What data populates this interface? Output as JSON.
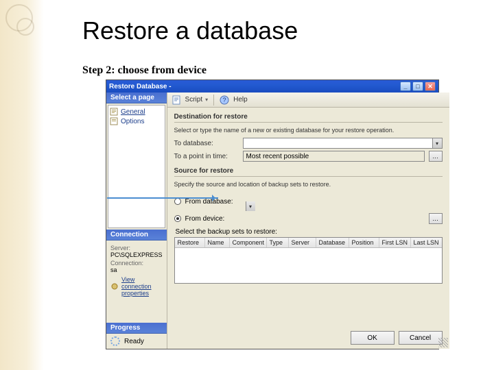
{
  "slide": {
    "title": "Restore a database",
    "step": "Step 2: choose from device"
  },
  "dialog": {
    "title": "Restore Database -",
    "winbtns": {
      "min": "_",
      "max": "□",
      "close": "✕"
    }
  },
  "left": {
    "select_page_header": "Select a page",
    "pages": [
      {
        "label": "General"
      },
      {
        "label": "Options"
      }
    ],
    "connection_header": "Connection",
    "server_label": "Server:",
    "server_value": "PC\\SQLEXPRESS",
    "connection_label": "Connection:",
    "connection_value": "sa",
    "view_props": "View connection properties",
    "progress_header": "Progress",
    "progress_state": "Ready"
  },
  "toolbar": {
    "script": "Script",
    "help": "Help"
  },
  "main": {
    "dest_section": "Destination for restore",
    "dest_desc": "Select or type the name of a new or existing database for your restore operation.",
    "to_db_label": "To database:",
    "to_db_value": "",
    "to_point_label": "To a point in time:",
    "to_point_value": "Most recent possible",
    "source_section": "Source for restore",
    "source_desc": "Specify the source and location of backup sets to restore.",
    "from_db_label": "From database:",
    "from_db_value": "",
    "from_device_label": "From device:",
    "from_device_value": "",
    "from_device_selected": true,
    "grid_label": "Select the backup sets to restore:",
    "grid_cols": [
      "Restore",
      "Name",
      "Component",
      "Type",
      "Server",
      "Database",
      "Position",
      "First LSN",
      "Last LSN"
    ],
    "ok": "OK",
    "cancel": "Cancel",
    "ellipsis": "…"
  }
}
